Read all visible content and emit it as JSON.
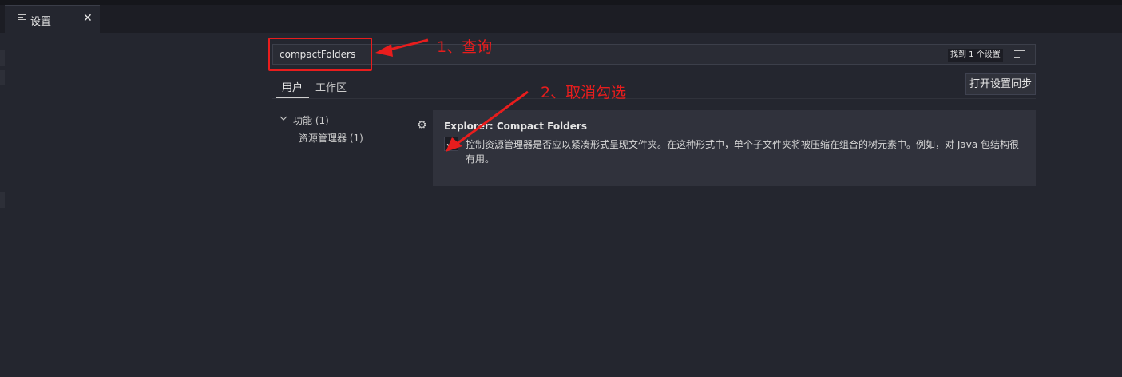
{
  "tab": {
    "title": "设置",
    "close": "✕",
    "icon": "list-icon"
  },
  "search": {
    "value": "compactFolders",
    "result_count": "找到 1 个设置",
    "clear_icon": "clear-filter-icon"
  },
  "scope_tabs": [
    {
      "label": "用户",
      "active": true
    },
    {
      "label": "工作区",
      "active": false
    }
  ],
  "sync_button": {
    "label": "打开设置同步"
  },
  "toc": [
    {
      "label": "功能 (1)",
      "expanded": true
    },
    {
      "label": "资源管理器 (1)"
    }
  ],
  "setting": {
    "title": "Explorer: Compact Folders",
    "checked": true,
    "description": "控制资源管理器是否应以紧凑形式呈现文件夹。在这种形式中，单个子文件夹将被压缩在组合的树元素中。例如，对 Java 包结构很有用。"
  },
  "annotations": {
    "step1": "1、查询",
    "step2": "2、取消勾选",
    "color": "#e81d1d"
  }
}
